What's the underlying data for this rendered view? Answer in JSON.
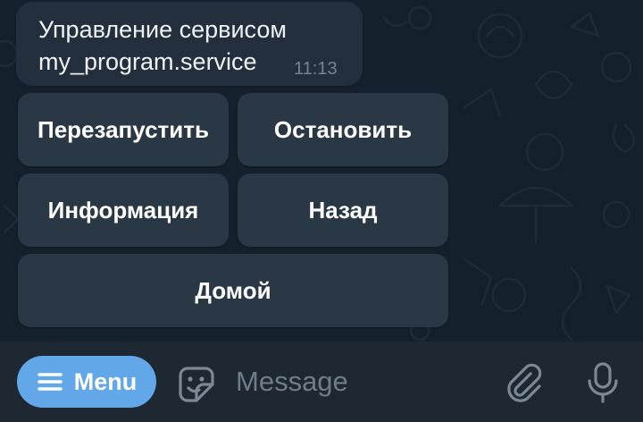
{
  "chat": {
    "message": {
      "line1": "Управление сервисом",
      "line2": "my_program.service",
      "time": "11:13"
    },
    "keyboard": {
      "restart": "Перезапустить",
      "stop": "Остановить",
      "info": "Информация",
      "back": "Назад",
      "home": "Домой"
    }
  },
  "composer": {
    "menu_label": "Menu",
    "message_placeholder": "Message",
    "icons": {
      "menu": "hamburger-menu-icon",
      "sticker": "sticker-emoji-icon",
      "attach": "paperclip-icon",
      "mic": "microphone-icon"
    }
  },
  "colors": {
    "background": "#14202b",
    "bubble": "#232f3c",
    "keyboard_button": "#2a3845",
    "bottom_bar": "#1d2833",
    "menu_button": "#62a8e8",
    "icon_gray": "#7c8894"
  }
}
